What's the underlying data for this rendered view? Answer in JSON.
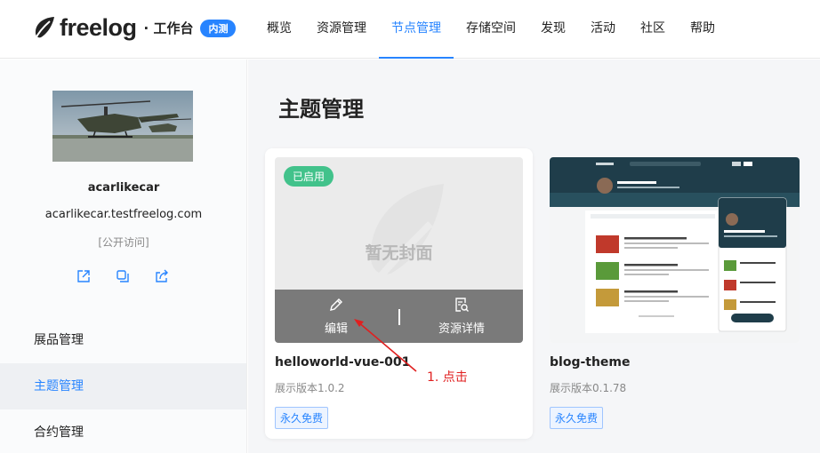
{
  "header": {
    "logo_text": "freelog",
    "workspace_label": "· 工作台",
    "beta_badge": "内测",
    "nav": [
      {
        "label": "概览"
      },
      {
        "label": "资源管理"
      },
      {
        "label": "节点管理",
        "active": true
      },
      {
        "label": "存储空间"
      },
      {
        "label": "发现"
      },
      {
        "label": "活动"
      },
      {
        "label": "社区"
      },
      {
        "label": "帮助"
      }
    ]
  },
  "sidebar": {
    "node_name": "acarlikecar",
    "node_domain": "acarlikecar.testfreelog.com",
    "access": "[公开访问]",
    "action_icons": [
      "external-link-icon",
      "copy-icon",
      "share-icon"
    ],
    "items": [
      {
        "label": "展品管理"
      },
      {
        "label": "主题管理",
        "active": true
      },
      {
        "label": "合约管理"
      }
    ]
  },
  "main": {
    "title": "主题管理",
    "cards": [
      {
        "name": "helloworld-vue-001",
        "status": "已启用",
        "cover_placeholder": "暂无封面",
        "edit_label": "编辑",
        "detail_label": "资源详情",
        "version": "展示版本1.0.2",
        "badge": "永久免费"
      },
      {
        "name": "blog-theme",
        "version": "展示版本0.1.78",
        "badge": "永久免费"
      }
    ]
  },
  "annotation": {
    "text": "1. 点击"
  },
  "colors": {
    "accent": "#2784ff",
    "active_status": "#42c28b",
    "annotation": "#e02020"
  }
}
